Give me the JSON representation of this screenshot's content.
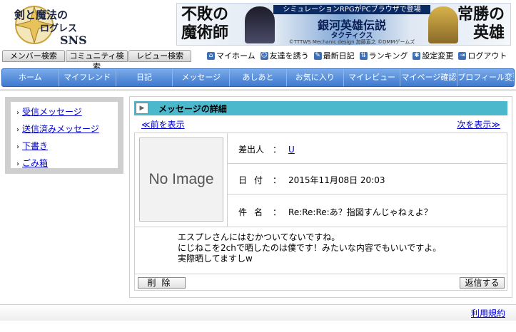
{
  "logo": {
    "text_top": "剣と魔法の",
    "text_mid": "ログレス",
    "text_sns": "SNS"
  },
  "banner": {
    "left_title": [
      "不敗の",
      "魔術師"
    ],
    "top_strip": "シミュレーションRPGがPCブラウザで登場",
    "title": "銀河英雄伝説",
    "subtitle": "タクティクス",
    "copyright": "©TTTWS Mechanic design 加藤直之 ©DMMゲームズ",
    "right_title": [
      "常勝の",
      "英雄"
    ]
  },
  "search_tabs": [
    "メンバー検索",
    "コミュニティ検索",
    "レビュー検索"
  ],
  "util_nav": [
    {
      "label": "マイホーム",
      "icon": "home-icon",
      "glyph": "⌂"
    },
    {
      "label": "友達を誘う",
      "icon": "person-icon",
      "glyph": "☺"
    },
    {
      "label": "最新日記",
      "icon": "pencil-icon",
      "glyph": "✎"
    },
    {
      "label": "ランキング",
      "icon": "ranking-icon",
      "glyph": "⇅"
    },
    {
      "label": "設定変更",
      "icon": "gear-icon",
      "glyph": "✱"
    },
    {
      "label": "ログアウト",
      "icon": "logout-icon",
      "glyph": "⇥"
    }
  ],
  "main_nav": [
    "ホーム",
    "マイフレンド",
    "日記",
    "メッセージ",
    "あしあと",
    "お気に入り",
    "マイレビュー",
    "マイページ確認",
    "プロフィール変更"
  ],
  "sidebar": {
    "items": [
      "受信メッセージ",
      "送信済みメッセージ",
      "下書き",
      "ごみ箱"
    ]
  },
  "content": {
    "title": "メッセージの詳細",
    "prev": "≪前を表示",
    "next": "次を表示≫",
    "no_image": "No Image",
    "sender_label": "差出人",
    "sender": "U",
    "date_label": "日付",
    "date": "2015年11月08日 20:03",
    "subject_label": "件名",
    "subject": "Re:Re:Re:あ？指図すんじゃねぇよ？",
    "body": [
      "エスプレさんにはむかついてないですね。",
      "にじねこを2chで晒したのは僕です！みたいな内容でもいいですよ。",
      "実際晒してますしw"
    ],
    "delete_button": "削除",
    "reply_button": "返信する"
  },
  "footer": {
    "terms": "利用規約"
  }
}
